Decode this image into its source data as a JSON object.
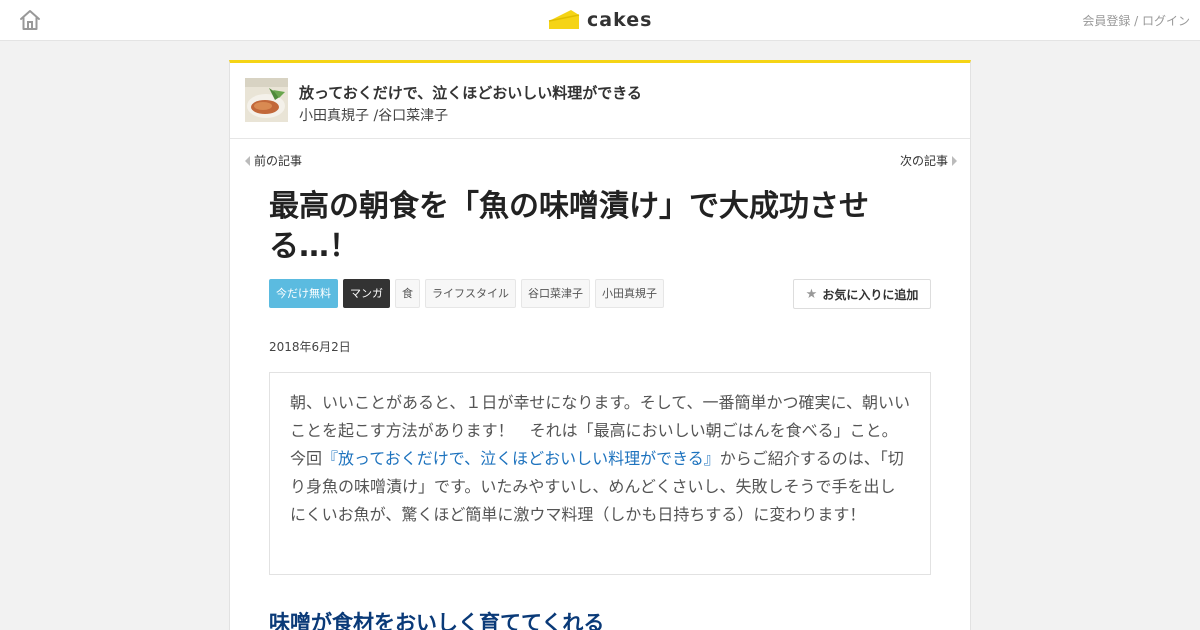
{
  "header": {
    "logo_text": "cakes",
    "auth_links": "会員登録 / ログイン",
    "home_icon": "home-icon",
    "logo_icon": "cake-slice-icon"
  },
  "series": {
    "title": "放っておくだけで、泣くほどおいしい料理ができる",
    "authors": "小田真規子 /谷口菜津子"
  },
  "nav": {
    "prev": "前の記事",
    "next": "次の記事"
  },
  "article": {
    "title": "最高の朝食を「魚の味噌漬け」で大成功させる…！",
    "tags": [
      "今だけ無料",
      "マンガ",
      "食",
      "ライフスタイル",
      "谷口菜津子",
      "小田真規子"
    ],
    "favorite_label": "お気に入りに追加",
    "date": "2018年6月2日",
    "lead_before": "朝、いいことがあると、１日が幸せになります。そして、一番簡単かつ確実に、朝いいことを起こす方法があります！　それは「最高においしい朝ごはんを食べる」こと。今回",
    "lead_link": "『放っておくだけで、泣くほどおいしい料理ができる』",
    "lead_after": "からご紹介するのは、「切り身魚の味噌漬け」です。いたみやすいし、めんどくさいし、失敗しそうで手を出しにくいお魚が、驚くほど簡単に激ウマ料理（しかも日持ちする）に変わります！",
    "section_heading": "味噌が食材をおいしく育ててくれる"
  },
  "colors": {
    "accent_yellow": "#f5d416",
    "free_tag": "#5bbbe0",
    "manga_tag": "#333333",
    "link": "#1e73be",
    "heading": "#0a3a78"
  }
}
